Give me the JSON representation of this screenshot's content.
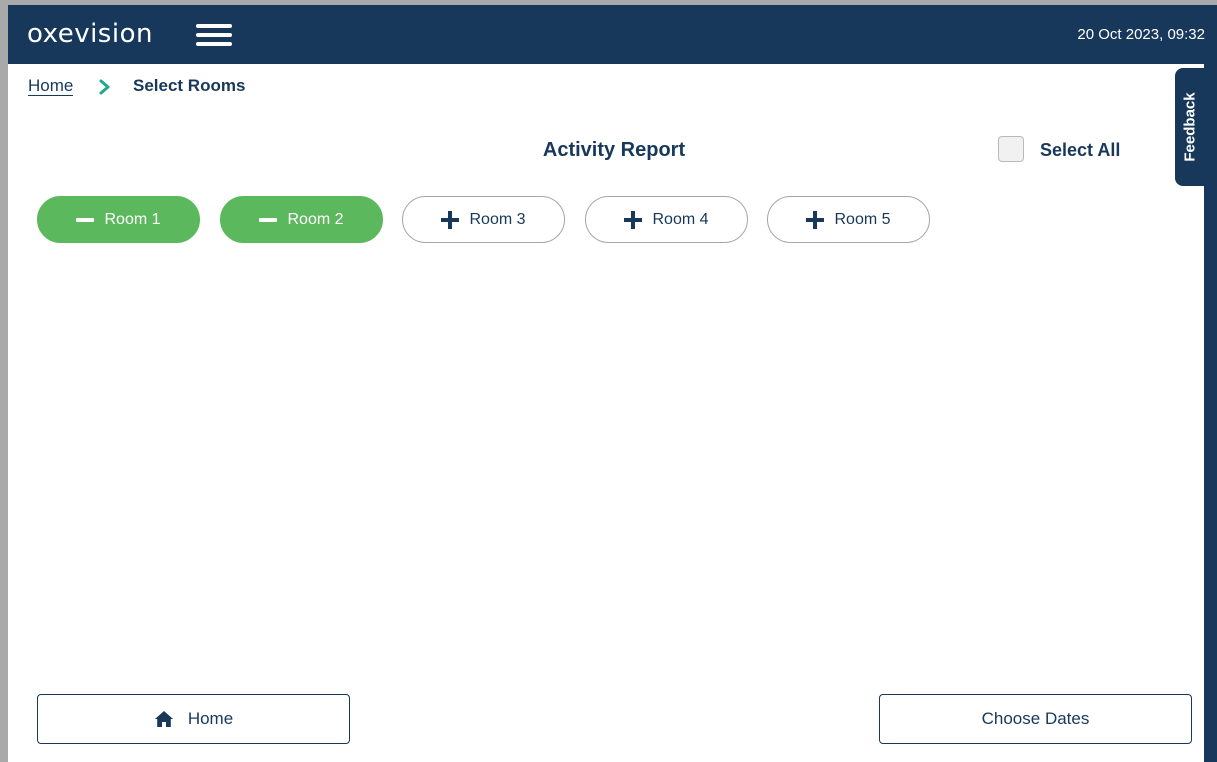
{
  "header": {
    "logo": "oxevision",
    "datetime": "20 Oct 2023, 09:32"
  },
  "breadcrumb": {
    "home": "Home",
    "current": "Select Rooms"
  },
  "feedback": {
    "label": "Feedback"
  },
  "page": {
    "title": "Activity Report",
    "select_all_label": "Select All",
    "select_all_checked": false
  },
  "rooms": [
    {
      "label": "Room 1",
      "selected": true
    },
    {
      "label": "Room 2",
      "selected": true
    },
    {
      "label": "Room 3",
      "selected": false
    },
    {
      "label": "Room 4",
      "selected": false
    },
    {
      "label": "Room 5",
      "selected": false
    }
  ],
  "footer": {
    "home_label": "Home",
    "choose_dates_label": "Choose Dates"
  },
  "colors": {
    "primary": "#17385b",
    "selected": "#5cb85c",
    "breadcrumb_chevron": "#1fa98a"
  },
  "icons": {
    "menu": "hamburger-menu-icon",
    "breadcrumb_separator": "chevron-right-icon",
    "room_selected": "minus-icon",
    "room_unselected": "plus-icon",
    "home_button": "home-icon"
  }
}
